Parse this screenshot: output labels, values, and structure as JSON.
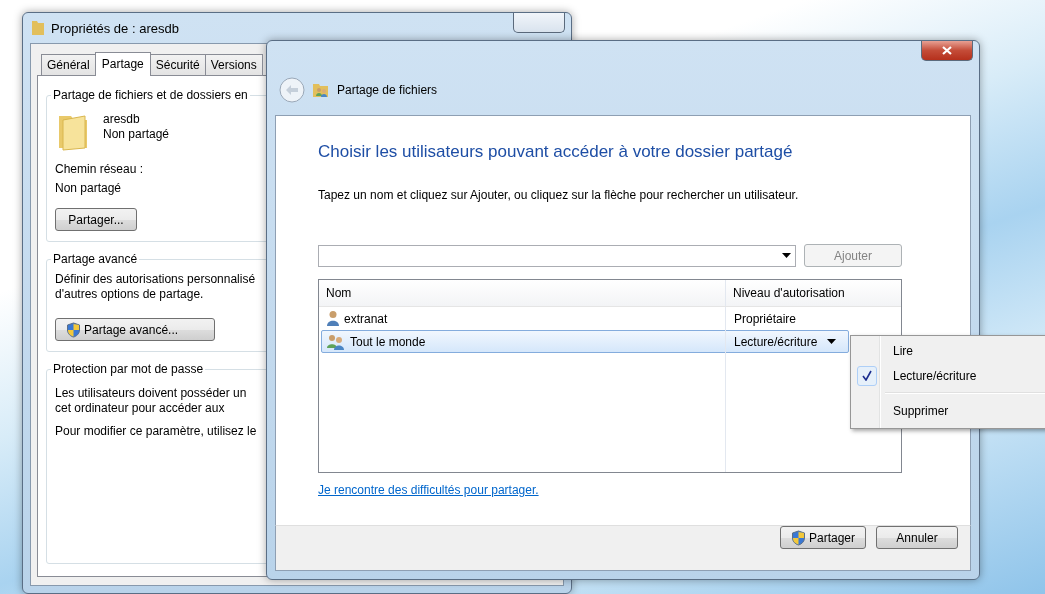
{
  "properties_window": {
    "title": "Propriétés de : aresdb",
    "tabs": [
      {
        "label": "Général",
        "selected": false
      },
      {
        "label": "Partage",
        "selected": true
      },
      {
        "label": "Sécurité",
        "selected": false
      },
      {
        "label": "Versions",
        "selected": false
      }
    ],
    "sharing_group": {
      "title": "Partage de fichiers et de dossiers en",
      "folder_name": "aresdb",
      "folder_status": "Non partagé",
      "network_path_label": "Chemin réseau :",
      "network_path": "Non partagé",
      "button": "Partager..."
    },
    "advanced_group": {
      "title": "Partage avancé",
      "description": [
        "Définir des autorisations personnalisé",
        "d'autres options de partage."
      ],
      "button": "Partage avancé..."
    },
    "password_group": {
      "title": "Protection par mot de passe",
      "paragraphs": [
        [
          "Les utilisateurs doivent posséder un",
          "cet ordinateur pour accéder aux"
        ],
        [
          "Pour modifier ce paramètre, utilisez le"
        ]
      ]
    }
  },
  "sharing_window": {
    "title": "Partage de fichiers",
    "heading": "Choisir les utilisateurs pouvant accéder à votre dossier partagé",
    "instruction": "Tapez un nom et cliquez sur Ajouter, ou cliquez sur la flèche pour rechercher un utilisateur.",
    "add_button": {
      "label": "Ajouter",
      "disabled": true
    },
    "table": {
      "columns": [
        "Nom",
        "Niveau d'autorisation"
      ],
      "rows": [
        {
          "name": "extranat",
          "kind": "user",
          "level": "Propriétaire",
          "selected": false
        },
        {
          "name": "Tout le monde",
          "kind": "group",
          "level": "Lecture/écriture",
          "selected": true
        }
      ]
    },
    "help_link": "Je rencontre des difficultés pour partager.",
    "buttons": [
      {
        "label": "Partager",
        "shield": true
      },
      {
        "label": "Annuler",
        "shield": false
      }
    ]
  },
  "permission_menu": {
    "items": [
      {
        "label": "Lire",
        "kind": "option",
        "checked": false
      },
      {
        "label": "Lecture/écriture",
        "kind": "option",
        "checked": true
      },
      {
        "label": "Supprimer",
        "kind": "action",
        "checked": false
      }
    ]
  }
}
